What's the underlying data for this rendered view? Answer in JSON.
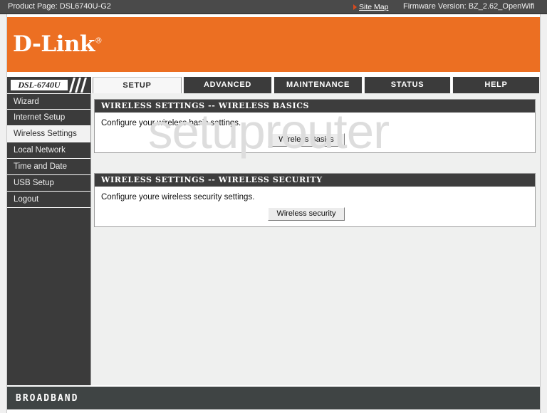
{
  "titlebar": {
    "product_page": "Product Page: DSL6740U-G2",
    "site_map_label": "Site Map",
    "firmware": "Firmware Version: BZ_2.62_OpenWifi",
    "arrow_icon": "arrow-right-icon",
    "bg_color": "#4a4a4a"
  },
  "banner": {
    "logo_text": "D-Link",
    "logo_registered": "®",
    "bg_color": "#ec6f22"
  },
  "nav": {
    "model": "DSL-6740U",
    "tabs": [
      {
        "label": "SETUP",
        "active": true
      },
      {
        "label": "ADVANCED",
        "active": false
      },
      {
        "label": "MAINTENANCE",
        "active": false
      },
      {
        "label": "STATUS",
        "active": false
      },
      {
        "label": "HELP",
        "active": false
      }
    ]
  },
  "sidebar": {
    "items": [
      {
        "label": "Wizard",
        "active": false
      },
      {
        "label": "Internet Setup",
        "active": false
      },
      {
        "label": "Wireless Settings",
        "active": true
      },
      {
        "label": "Local Network",
        "active": false
      },
      {
        "label": "Time and Date",
        "active": false
      },
      {
        "label": "USB Setup",
        "active": false
      },
      {
        "label": "Logout",
        "active": false
      }
    ],
    "bg_color": "#3b3b3b"
  },
  "main": {
    "watermark": "setuprouter",
    "panels": [
      {
        "header": "WIRELESS SETTINGS -- WIRELESS BASICS",
        "description": "Configure your wireless basic settings.",
        "button_label": "Wireless Basics"
      },
      {
        "header": "WIRELESS SETTINGS -- WIRELESS SECURITY",
        "description": "Configure youre wireless security settings.",
        "button_label": "Wireless security"
      }
    ]
  },
  "footer": {
    "brand": "BROADBAND",
    "bg_color": "#3f4444"
  }
}
